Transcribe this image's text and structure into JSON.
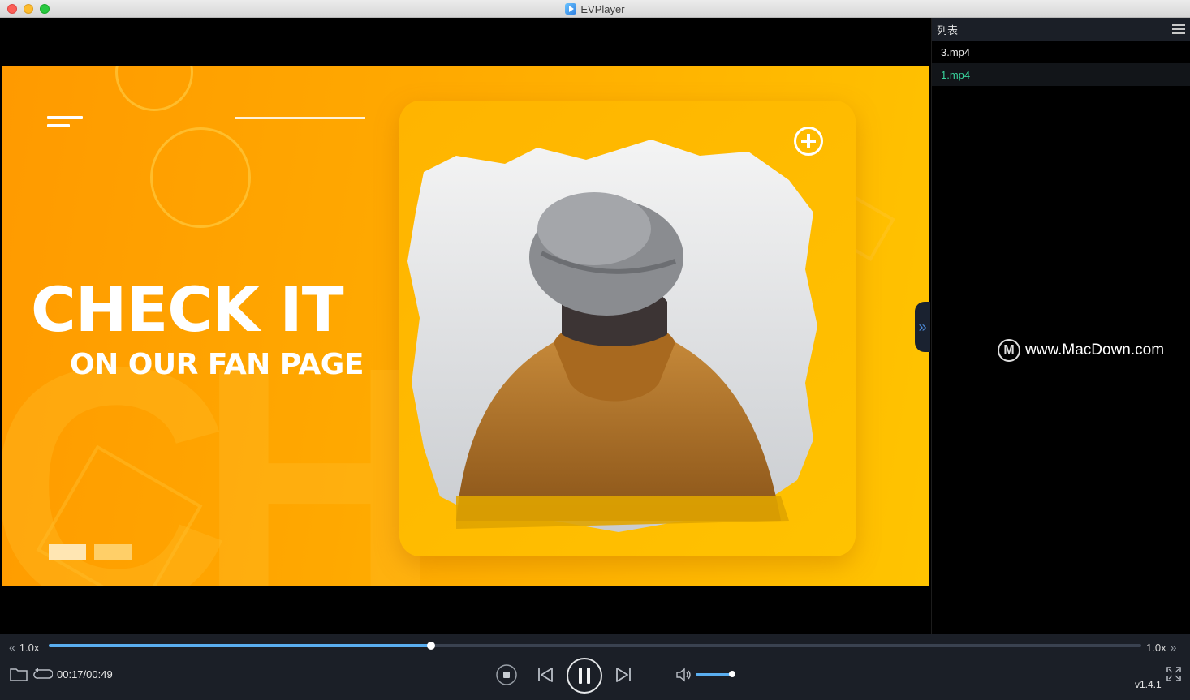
{
  "window": {
    "title": "EVPlayer"
  },
  "video": {
    "headline": "CHECK IT",
    "subline": "ON OUR FAN PAGE"
  },
  "playlist": {
    "title": "列表",
    "items": [
      {
        "label": "3.mp4",
        "active": false
      },
      {
        "label": "1.mp4",
        "active": true
      }
    ]
  },
  "watermark": {
    "logo_letter": "M",
    "text": "www.MacDown.com"
  },
  "controls": {
    "speed_left": "1.0x",
    "speed_right": "1.0x",
    "time": "00:17/00:49",
    "progress": 0.35,
    "volume": 0.9,
    "version": "v1.4.1"
  },
  "colors": {
    "accent": "#5aaef0",
    "active_item": "#39d39c",
    "panel_bg": "#1b1f27",
    "frame_orange": "#ffa800"
  },
  "icons": [
    "folder-icon",
    "loop-icon",
    "stop-icon",
    "previous-icon",
    "pause-icon",
    "next-icon",
    "volume-icon",
    "fullscreen-icon",
    "list-icon",
    "expand-panel-icon",
    "plus-circle-icon"
  ]
}
